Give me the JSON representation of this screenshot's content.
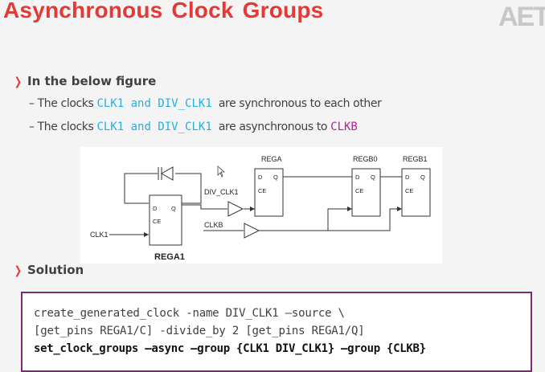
{
  "slide": {
    "title": "Asynchronous Clock Groups",
    "logo": "AET"
  },
  "sections": {
    "figure_heading": "In the below figure",
    "solution_heading": "Solution"
  },
  "bullets": [
    {
      "dash": "– The clocks ",
      "clocks": "CLK1 and DIV_CLK1",
      "rest": "are synchronous to each other",
      "target": ""
    },
    {
      "dash": "– The clocks ",
      "clocks": "CLK1 and DIV_CLK1",
      "rest": "are asynchronous to ",
      "target": "CLKB"
    }
  ],
  "figure": {
    "labels": {
      "rega": "REGA",
      "regb0": "REGB0",
      "regb1": "REGB1",
      "rega1": "REGA1",
      "div_clk1": "DIV_CLK1",
      "clkb": "CLKB",
      "clk1": "CLK1",
      "pin_d": "D",
      "pin_q": "Q",
      "pin_ce": "CE"
    }
  },
  "code": {
    "line1": "create_generated_clock -name DIV_CLK1 –source \\",
    "line2": "[get_pins REGA1/C] -divide_by 2 [get_pins REGA1/Q]",
    "line3": "set_clock_groups –async –group {CLK1 DIV_CLK1} –group {CLKB}"
  },
  "colors": {
    "accent": "#e53935",
    "clock_name": "#27aee0",
    "clock_b": "#b0279c",
    "code_border": "#7e2a70"
  }
}
